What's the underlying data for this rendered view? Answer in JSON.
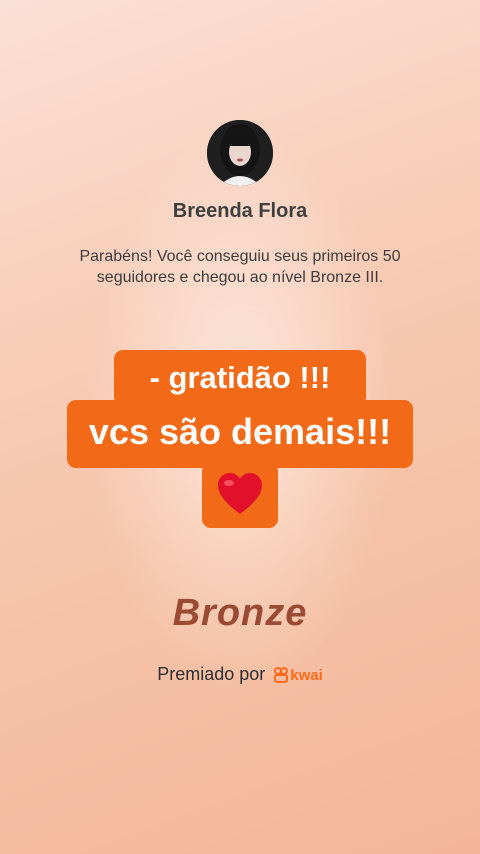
{
  "profile": {
    "name": "Breenda Flora",
    "message": "Parabéns! Você conseguiu seus primeiros 50 seguidores e chegou ao nível Bronze III."
  },
  "caption": {
    "line1": "- gratidão !!!",
    "line2": "vcs são demais!!!",
    "emoji": "❤️"
  },
  "level": {
    "title": "Bronze"
  },
  "award": {
    "label": "Premiado por",
    "brand": "kwai",
    "brand_color": "#ff6a1a"
  },
  "colors": {
    "caption_bg": "#f26a17",
    "bronze_text": "#9b4a33"
  },
  "icons": {
    "avatar": "profile-photo",
    "logo": "kwai-logo-icon"
  }
}
